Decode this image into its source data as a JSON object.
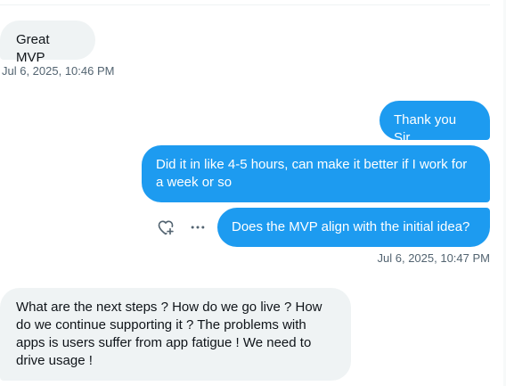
{
  "conversation": {
    "messages": [
      {
        "direction": "incoming",
        "text": "Great MVP"
      },
      {
        "direction": "outgoing",
        "text": "Thank you Sir"
      },
      {
        "direction": "outgoing",
        "text": "Did it in like 4-5 hours, can make it better if I work for a week or so"
      },
      {
        "direction": "outgoing",
        "text": "Does the MVP align with the initial idea?"
      },
      {
        "direction": "incoming",
        "text": "What are the next steps ? How do we go live ? How do we continue supporting it ? The problems with apps is users suffer from app fatigue ! We need to drive usage !"
      }
    ],
    "timestamps": {
      "first": "Jul 6, 2025, 10:46 PM",
      "second": "Jul 6, 2025, 10:47 PM"
    }
  },
  "actions": {
    "react_icon": "heart-plus-icon",
    "more_icon": "more-horizontal-icon"
  },
  "colors": {
    "outgoing_bubble": "#1d9bf0",
    "incoming_bubble": "#eff3f4",
    "timestamp_text": "#536471",
    "icon": "#536471"
  }
}
